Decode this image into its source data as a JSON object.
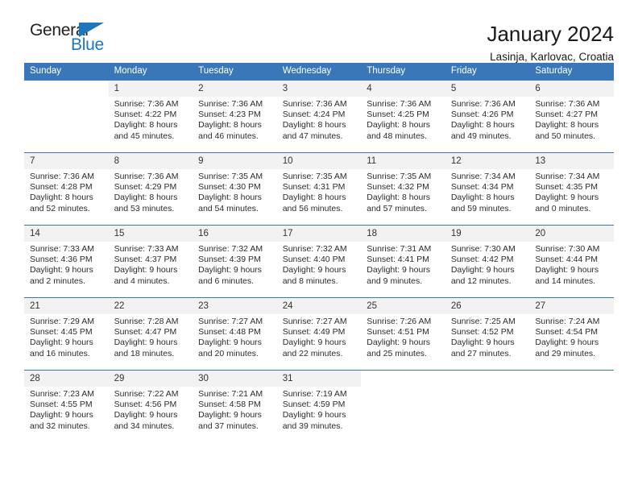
{
  "logo": {
    "word_one": "General",
    "word_two": "Blue",
    "triangle_color": "#1e76bd"
  },
  "header": {
    "title": "January 2024",
    "location": "Lasinja, Karlovac, Croatia"
  },
  "theme": {
    "header_blue": "#3a77b8",
    "daynum_gray": "#f2f2f2",
    "text": "#2b2b2b"
  },
  "calendar": {
    "weekday_headers": [
      "Sunday",
      "Monday",
      "Tuesday",
      "Wednesday",
      "Thursday",
      "Friday",
      "Saturday"
    ],
    "weeks": [
      [
        {
          "day": "",
          "empty": true,
          "blank": true,
          "sunrise": "",
          "sunset": "",
          "daylight1": "",
          "daylight2": ""
        },
        {
          "day": "1",
          "sunrise": "Sunrise: 7:36 AM",
          "sunset": "Sunset: 4:22 PM",
          "daylight1": "Daylight: 8 hours",
          "daylight2": "and 45 minutes."
        },
        {
          "day": "2",
          "sunrise": "Sunrise: 7:36 AM",
          "sunset": "Sunset: 4:23 PM",
          "daylight1": "Daylight: 8 hours",
          "daylight2": "and 46 minutes."
        },
        {
          "day": "3",
          "sunrise": "Sunrise: 7:36 AM",
          "sunset": "Sunset: 4:24 PM",
          "daylight1": "Daylight: 8 hours",
          "daylight2": "and 47 minutes."
        },
        {
          "day": "4",
          "sunrise": "Sunrise: 7:36 AM",
          "sunset": "Sunset: 4:25 PM",
          "daylight1": "Daylight: 8 hours",
          "daylight2": "and 48 minutes."
        },
        {
          "day": "5",
          "sunrise": "Sunrise: 7:36 AM",
          "sunset": "Sunset: 4:26 PM",
          "daylight1": "Daylight: 8 hours",
          "daylight2": "and 49 minutes."
        },
        {
          "day": "6",
          "sunrise": "Sunrise: 7:36 AM",
          "sunset": "Sunset: 4:27 PM",
          "daylight1": "Daylight: 8 hours",
          "daylight2": "and 50 minutes."
        }
      ],
      [
        {
          "day": "7",
          "sunrise": "Sunrise: 7:36 AM",
          "sunset": "Sunset: 4:28 PM",
          "daylight1": "Daylight: 8 hours",
          "daylight2": "and 52 minutes."
        },
        {
          "day": "8",
          "sunrise": "Sunrise: 7:36 AM",
          "sunset": "Sunset: 4:29 PM",
          "daylight1": "Daylight: 8 hours",
          "daylight2": "and 53 minutes."
        },
        {
          "day": "9",
          "sunrise": "Sunrise: 7:35 AM",
          "sunset": "Sunset: 4:30 PM",
          "daylight1": "Daylight: 8 hours",
          "daylight2": "and 54 minutes."
        },
        {
          "day": "10",
          "sunrise": "Sunrise: 7:35 AM",
          "sunset": "Sunset: 4:31 PM",
          "daylight1": "Daylight: 8 hours",
          "daylight2": "and 56 minutes."
        },
        {
          "day": "11",
          "sunrise": "Sunrise: 7:35 AM",
          "sunset": "Sunset: 4:32 PM",
          "daylight1": "Daylight: 8 hours",
          "daylight2": "and 57 minutes."
        },
        {
          "day": "12",
          "sunrise": "Sunrise: 7:34 AM",
          "sunset": "Sunset: 4:34 PM",
          "daylight1": "Daylight: 8 hours",
          "daylight2": "and 59 minutes."
        },
        {
          "day": "13",
          "sunrise": "Sunrise: 7:34 AM",
          "sunset": "Sunset: 4:35 PM",
          "daylight1": "Daylight: 9 hours",
          "daylight2": "and 0 minutes."
        }
      ],
      [
        {
          "day": "14",
          "sunrise": "Sunrise: 7:33 AM",
          "sunset": "Sunset: 4:36 PM",
          "daylight1": "Daylight: 9 hours",
          "daylight2": "and 2 minutes."
        },
        {
          "day": "15",
          "sunrise": "Sunrise: 7:33 AM",
          "sunset": "Sunset: 4:37 PM",
          "daylight1": "Daylight: 9 hours",
          "daylight2": "and 4 minutes."
        },
        {
          "day": "16",
          "sunrise": "Sunrise: 7:32 AM",
          "sunset": "Sunset: 4:39 PM",
          "daylight1": "Daylight: 9 hours",
          "daylight2": "and 6 minutes."
        },
        {
          "day": "17",
          "sunrise": "Sunrise: 7:32 AM",
          "sunset": "Sunset: 4:40 PM",
          "daylight1": "Daylight: 9 hours",
          "daylight2": "and 8 minutes."
        },
        {
          "day": "18",
          "sunrise": "Sunrise: 7:31 AM",
          "sunset": "Sunset: 4:41 PM",
          "daylight1": "Daylight: 9 hours",
          "daylight2": "and 9 minutes."
        },
        {
          "day": "19",
          "sunrise": "Sunrise: 7:30 AM",
          "sunset": "Sunset: 4:42 PM",
          "daylight1": "Daylight: 9 hours",
          "daylight2": "and 12 minutes."
        },
        {
          "day": "20",
          "sunrise": "Sunrise: 7:30 AM",
          "sunset": "Sunset: 4:44 PM",
          "daylight1": "Daylight: 9 hours",
          "daylight2": "and 14 minutes."
        }
      ],
      [
        {
          "day": "21",
          "sunrise": "Sunrise: 7:29 AM",
          "sunset": "Sunset: 4:45 PM",
          "daylight1": "Daylight: 9 hours",
          "daylight2": "and 16 minutes."
        },
        {
          "day": "22",
          "sunrise": "Sunrise: 7:28 AM",
          "sunset": "Sunset: 4:47 PM",
          "daylight1": "Daylight: 9 hours",
          "daylight2": "and 18 minutes."
        },
        {
          "day": "23",
          "sunrise": "Sunrise: 7:27 AM",
          "sunset": "Sunset: 4:48 PM",
          "daylight1": "Daylight: 9 hours",
          "daylight2": "and 20 minutes."
        },
        {
          "day": "24",
          "sunrise": "Sunrise: 7:27 AM",
          "sunset": "Sunset: 4:49 PM",
          "daylight1": "Daylight: 9 hours",
          "daylight2": "and 22 minutes."
        },
        {
          "day": "25",
          "sunrise": "Sunrise: 7:26 AM",
          "sunset": "Sunset: 4:51 PM",
          "daylight1": "Daylight: 9 hours",
          "daylight2": "and 25 minutes."
        },
        {
          "day": "26",
          "sunrise": "Sunrise: 7:25 AM",
          "sunset": "Sunset: 4:52 PM",
          "daylight1": "Daylight: 9 hours",
          "daylight2": "and 27 minutes."
        },
        {
          "day": "27",
          "sunrise": "Sunrise: 7:24 AM",
          "sunset": "Sunset: 4:54 PM",
          "daylight1": "Daylight: 9 hours",
          "daylight2": "and 29 minutes."
        }
      ],
      [
        {
          "day": "28",
          "sunrise": "Sunrise: 7:23 AM",
          "sunset": "Sunset: 4:55 PM",
          "daylight1": "Daylight: 9 hours",
          "daylight2": "and 32 minutes."
        },
        {
          "day": "29",
          "sunrise": "Sunrise: 7:22 AM",
          "sunset": "Sunset: 4:56 PM",
          "daylight1": "Daylight: 9 hours",
          "daylight2": "and 34 minutes."
        },
        {
          "day": "30",
          "sunrise": "Sunrise: 7:21 AM",
          "sunset": "Sunset: 4:58 PM",
          "daylight1": "Daylight: 9 hours",
          "daylight2": "and 37 minutes."
        },
        {
          "day": "31",
          "sunrise": "Sunrise: 7:19 AM",
          "sunset": "Sunset: 4:59 PM",
          "daylight1": "Daylight: 9 hours",
          "daylight2": "and 39 minutes."
        },
        {
          "day": "",
          "empty": true,
          "blank": true,
          "sunrise": "",
          "sunset": "",
          "daylight1": "",
          "daylight2": ""
        },
        {
          "day": "",
          "empty": true,
          "blank": true,
          "sunrise": "",
          "sunset": "",
          "daylight1": "",
          "daylight2": ""
        },
        {
          "day": "",
          "empty": true,
          "blank": true,
          "sunrise": "",
          "sunset": "",
          "daylight1": "",
          "daylight2": ""
        }
      ]
    ]
  }
}
